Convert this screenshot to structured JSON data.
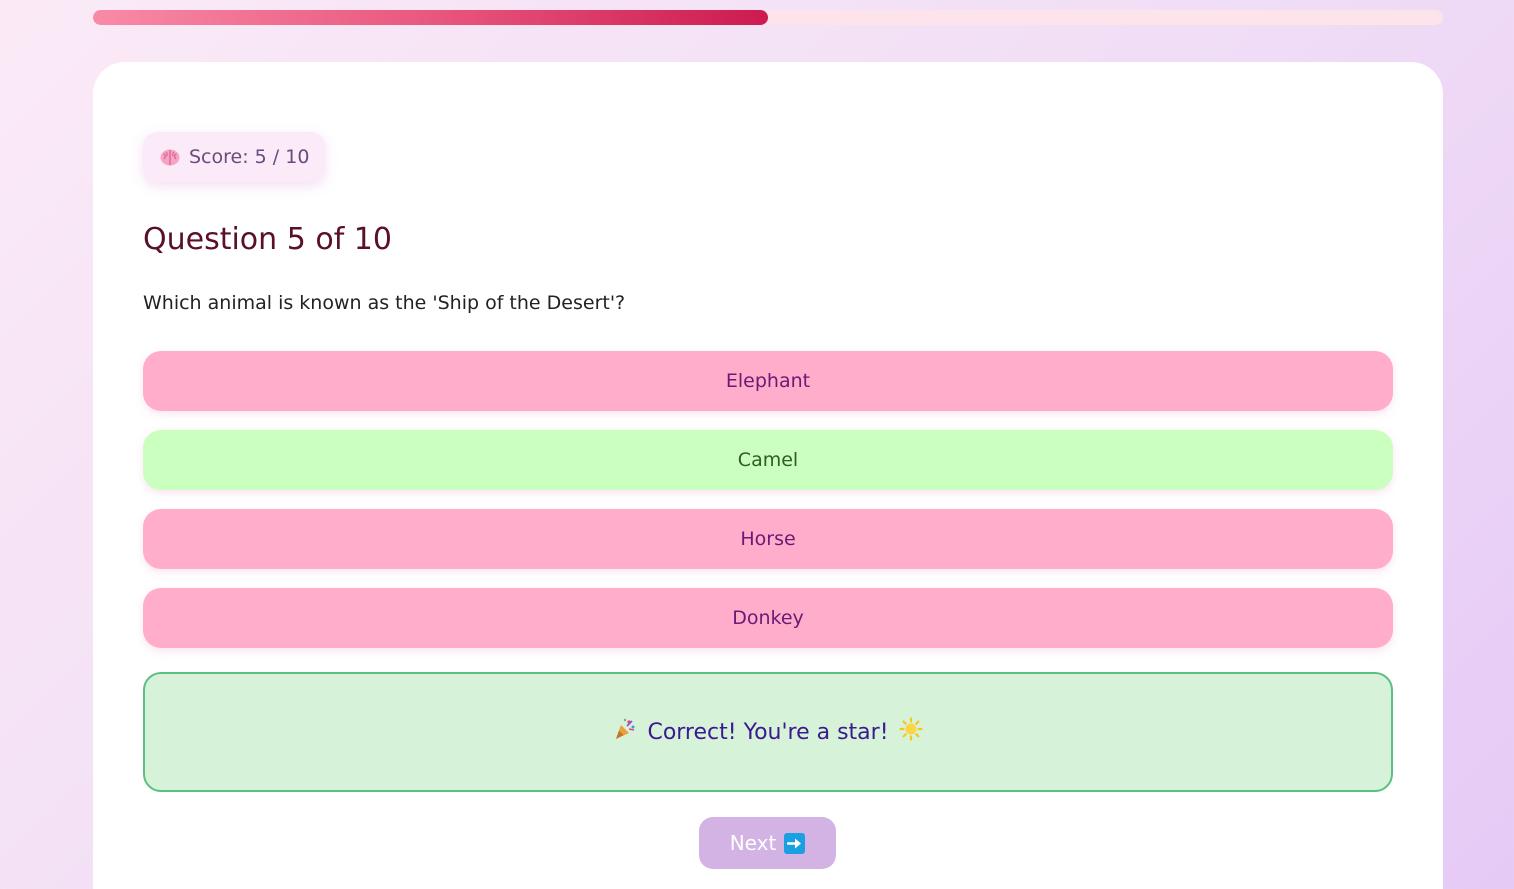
{
  "progress": {
    "fraction": 0.5,
    "fill_color": "#cc1b4f",
    "track_color": "#fde3ea"
  },
  "score": {
    "icon": "brain-icon",
    "label": "Score: 5 / 10"
  },
  "question": {
    "title": "Question 5 of 10",
    "text": "Which animal is known as the 'Ship of the Desert'?"
  },
  "options": [
    {
      "label": "Elephant",
      "state": "wrong"
    },
    {
      "label": "Camel",
      "state": "correct"
    },
    {
      "label": "Horse",
      "state": "wrong"
    },
    {
      "label": "Donkey",
      "state": "wrong"
    }
  ],
  "feedback": {
    "icon_left": "party-popper-icon",
    "text": "Correct! You're a star!",
    "icon_right": "sun-icon"
  },
  "next_button": {
    "label": "Next",
    "icon": "right-arrow-icon"
  },
  "colors": {
    "option_wrong_bg": "#ffadcb",
    "option_correct_bg": "#caffc0",
    "feedback_bg": "#d6f2d8",
    "feedback_border": "#5cbf82",
    "next_button_bg": "#d2b3e4"
  }
}
